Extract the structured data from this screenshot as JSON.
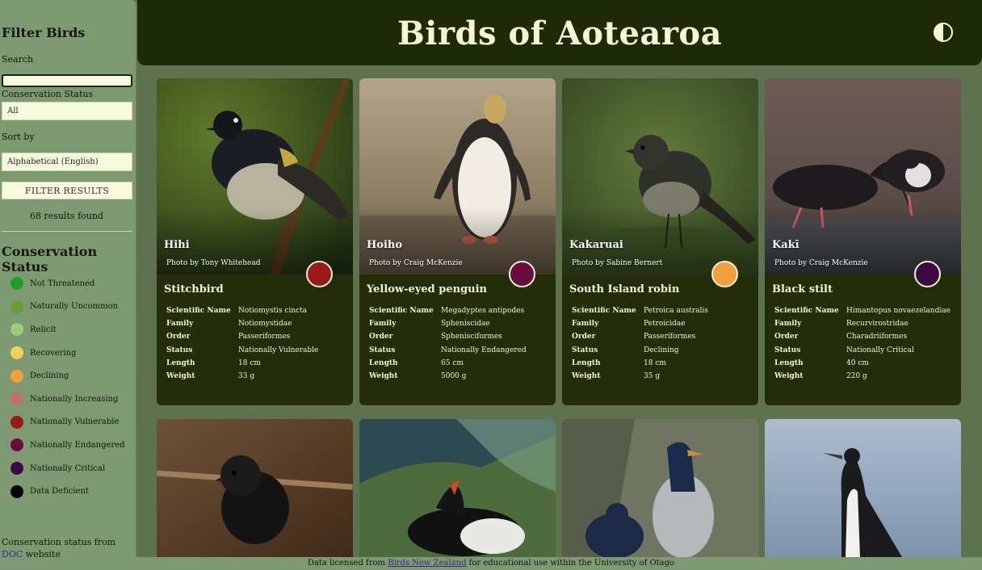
{
  "sidebar": {
    "title": "Filter Birds",
    "search_label": "Search",
    "search_value": "",
    "conservation_label": "Conservation Status",
    "conservation_value": "All",
    "sort_label": "Sort by",
    "sort_value": "Alphabetical (English)",
    "filter_button": "FILTER RESULTS",
    "results_text": "68 results found",
    "legend_title": "Conservation Status",
    "legend": [
      {
        "label": "Not Threatened",
        "color": "#1f9f2a"
      },
      {
        "label": "Naturally Uncommon",
        "color": "#6c9a36"
      },
      {
        "label": "Relicit",
        "color": "#9fcc7c"
      },
      {
        "label": "Recovering",
        "color": "#f2cf55"
      },
      {
        "label": "Declining",
        "color": "#f2a03f"
      },
      {
        "label": "Nationally Increasing",
        "color": "#c46f70"
      },
      {
        "label": "Nationally Vulnerable",
        "color": "#9b1a15"
      },
      {
        "label": "Nationally Endangered",
        "color": "#6a0c3e"
      },
      {
        "label": "Nationally Critical",
        "color": "#3b0a40"
      },
      {
        "label": "Data Deficient",
        "color": "#000000"
      }
    ],
    "source_prefix": "Conservation status from ",
    "source_link": "DOC",
    "source_suffix": " website"
  },
  "header": {
    "title": "Birds of Aotearoa",
    "toggle_icon": "contrast-icon"
  },
  "cards": [
    {
      "maori_name": "Hihi",
      "credit": "Photo by Tony Whitehead",
      "english_name": "Stitchbird",
      "status_color": "#9b1a15",
      "facts": [
        {
          "k": "Scientific Name",
          "v": "Notiomystis cincta"
        },
        {
          "k": "Family",
          "v": "Notiomystidae"
        },
        {
          "k": "Order",
          "v": "Passeriformes"
        },
        {
          "k": "Status",
          "v": "Nationally Vulnerable"
        },
        {
          "k": "Length",
          "v": "18 cm"
        },
        {
          "k": "Weight",
          "v": "33 g"
        }
      ]
    },
    {
      "maori_name": "Hoiho",
      "credit": "Photo by Craig McKenzie",
      "english_name": "Yellow-eyed penguin",
      "status_color": "#6a0c3e",
      "facts": [
        {
          "k": "Scientific Name",
          "v": "Megadyptes antipodes"
        },
        {
          "k": "Family",
          "v": "Spheniscidae"
        },
        {
          "k": "Order",
          "v": "Sphenisciformes"
        },
        {
          "k": "Status",
          "v": "Nationally Endangered"
        },
        {
          "k": "Length",
          "v": "65 cm"
        },
        {
          "k": "Weight",
          "v": "5000 g"
        }
      ]
    },
    {
      "maori_name": "Kakaruai",
      "credit": "Photo by Sabine Bernert",
      "english_name": "South Island robin",
      "status_color": "#f2a03f",
      "facts": [
        {
          "k": "Scientific Name",
          "v": "Petroica australis"
        },
        {
          "k": "Family",
          "v": "Petroicidae"
        },
        {
          "k": "Order",
          "v": "Passeriformes"
        },
        {
          "k": "Status",
          "v": "Declining"
        },
        {
          "k": "Length",
          "v": "18 cm"
        },
        {
          "k": "Weight",
          "v": "35 g"
        }
      ]
    },
    {
      "maori_name": "Kakī",
      "credit": "Photo by Craig McKenzie",
      "english_name": "Black stilt",
      "status_color": "#3b0a40",
      "facts": [
        {
          "k": "Scientific Name",
          "v": "Himantopus novaezelandiae"
        },
        {
          "k": "Family",
          "v": "Recurvirostridae"
        },
        {
          "k": "Order",
          "v": "Charadriiformes"
        },
        {
          "k": "Status",
          "v": "Nationally Critical"
        },
        {
          "k": "Length",
          "v": "40 cm"
        },
        {
          "k": "Weight",
          "v": "220 g"
        }
      ]
    }
  ],
  "footer": {
    "prefix": "Data licensed from ",
    "link": "Birds New Zealand",
    "suffix": " for educational use within the University of Otago"
  }
}
